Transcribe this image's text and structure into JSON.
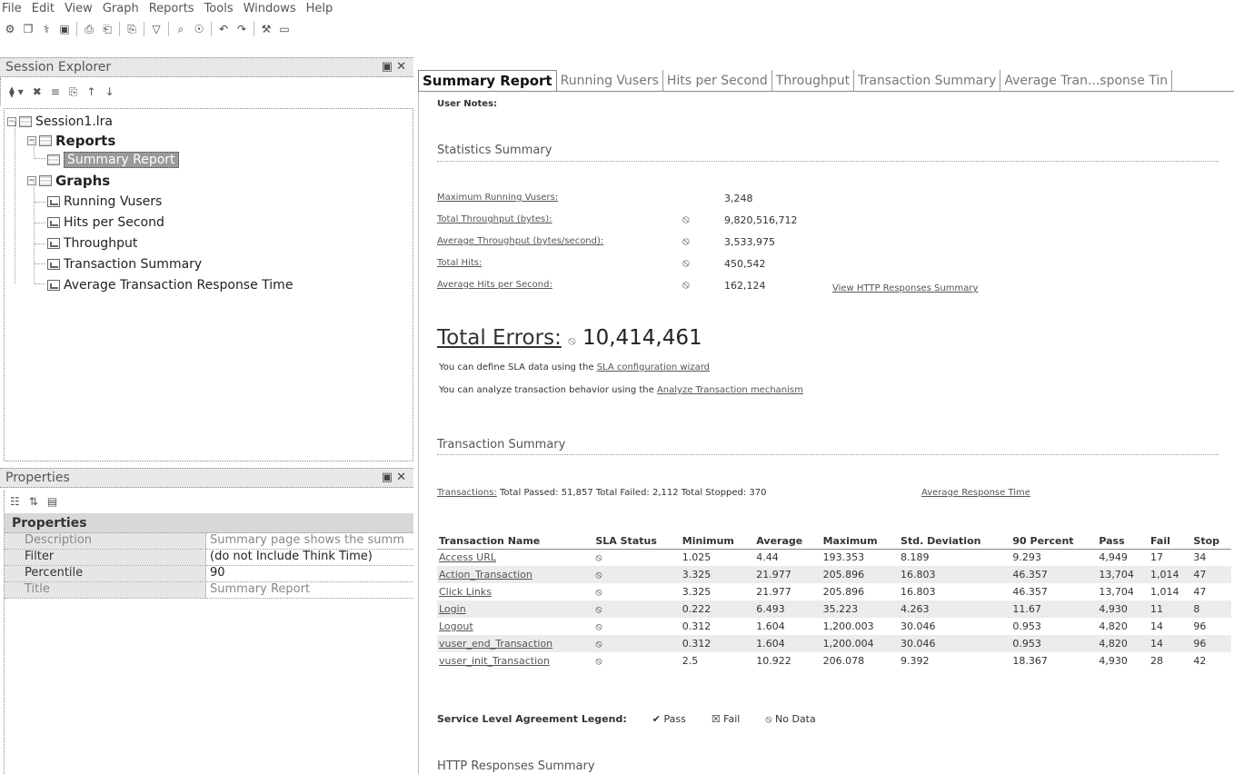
{
  "menu": [
    "File",
    "Edit",
    "View",
    "Graph",
    "Reports",
    "Tools",
    "Windows",
    "Help"
  ],
  "toolbar_icons": [
    "open-icon",
    "save-icon",
    "filter-icon",
    "report-icon",
    "sep",
    "print-icon",
    "preview-icon",
    "sep",
    "copy-icon",
    "sep",
    "funnel-icon",
    "sep",
    "zoom-icon",
    "find-icon",
    "sep",
    "undo-icon",
    "redo-icon",
    "sep",
    "settings-icon",
    "export-icon"
  ],
  "session_explorer": {
    "title": "Session Explorer",
    "pin": "▣ ✕",
    "toolbar": [
      "⧫ ▾",
      "✖",
      "≡",
      "⎘",
      "↑",
      "↓"
    ],
    "tree": {
      "root": "Session1.lra",
      "reports_label": "Reports",
      "summary_report": "Summary Report",
      "graphs_label": "Graphs",
      "graphs": [
        "Running Vusers",
        "Hits per Second",
        "Throughput",
        "Transaction Summary",
        "Average Transaction Response Time"
      ]
    }
  },
  "properties": {
    "title": "Properties",
    "pin": "▣ ✕",
    "toolbar": [
      "☷",
      "⇅",
      "▤"
    ],
    "category": "Properties",
    "rows": [
      {
        "name": "Description",
        "value": "Summary page shows the summ",
        "dim": true
      },
      {
        "name": "Filter",
        "value": "(do not Include Think Time)",
        "dim": false
      },
      {
        "name": "Percentile",
        "value": "90",
        "dim": false
      },
      {
        "name": "Title",
        "value": "Summary Report",
        "dim": true
      }
    ]
  },
  "tabs": [
    "Summary Report",
    "Running Vusers",
    "Hits per Second",
    "Throughput",
    "Transaction Summary",
    "Average Tran...sponse Tin"
  ],
  "report": {
    "user_notes": "User Notes:",
    "stats_title": "Statistics Summary",
    "stats": [
      {
        "label": "Maximum Running Vusers:",
        "icon": "",
        "value": "3,248"
      },
      {
        "label": "Total Throughput (bytes):",
        "icon": "⦸",
        "value": "9,820,516,712"
      },
      {
        "label": "Average Throughput (bytes/second):",
        "icon": "⦸",
        "value": "3,533,975"
      },
      {
        "label": "Total Hits:",
        "icon": "⦸",
        "value": "450,542"
      },
      {
        "label": "Average Hits per Second:",
        "icon": "⦸",
        "value": "162,124"
      }
    ],
    "http_summary_link": "View HTTP Responses Summary",
    "total_errors_label": "Total Errors:",
    "total_errors_icon": "⦸",
    "total_errors_value": "10,414,461",
    "sla_line_prefix": "You can define SLA data using the",
    "sla_line_link": "SLA configuration wizard",
    "analyze_line_prefix": "You can analyze transaction behavior using the",
    "analyze_line_link": "Analyze Transaction mechanism",
    "txn_summary_title": "Transaction Summary",
    "transactions_link": "Transactions:",
    "transactions_text": "Total Passed: 51,857 Total Failed: 2,112 Total Stopped: 370",
    "avg_response_link": "Average Response Time",
    "table": {
      "headers": [
        "Transaction Name",
        "SLA Status",
        "Minimum",
        "Average",
        "Maximum",
        "Std. Deviation",
        "90 Percent",
        "Pass",
        "Fail",
        "Stop"
      ],
      "rows": [
        [
          "Access URL",
          "⦸",
          "1.025",
          "4.44",
          "193.353",
          "8.189",
          "9.293",
          "4,949",
          "17",
          "34"
        ],
        [
          "Action_Transaction",
          "⦸",
          "3.325",
          "21.977",
          "205.896",
          "16.803",
          "46.357",
          "13,704",
          "1,014",
          "47"
        ],
        [
          "Click Links",
          "⦸",
          "3.325",
          "21.977",
          "205.896",
          "16.803",
          "46.357",
          "13,704",
          "1,014",
          "47"
        ],
        [
          "Login",
          "⦸",
          "0.222",
          "6.493",
          "35.223",
          "4.263",
          "11.67",
          "4,930",
          "11",
          "8"
        ],
        [
          "Logout",
          "⦸",
          "0.312",
          "1.604",
          "1,200.003",
          "30.046",
          "0.953",
          "4,820",
          "14",
          "96"
        ],
        [
          "vuser_end_Transaction",
          "⦸",
          "0.312",
          "1.604",
          "1,200.004",
          "30.046",
          "0.953",
          "4,820",
          "14",
          "96"
        ],
        [
          "vuser_init_Transaction",
          "⦸",
          "2.5",
          "10.922",
          "206.078",
          "9.392",
          "18.367",
          "4,930",
          "28",
          "42"
        ]
      ]
    },
    "sla_legend_label": "Service Level Agreement Legend:",
    "sla_legend": [
      {
        "icon": "✔",
        "label": "Pass"
      },
      {
        "icon": "☒",
        "label": "Fail"
      },
      {
        "icon": "⦸",
        "label": "No Data"
      }
    ],
    "http_title": "HTTP Responses Summary"
  }
}
